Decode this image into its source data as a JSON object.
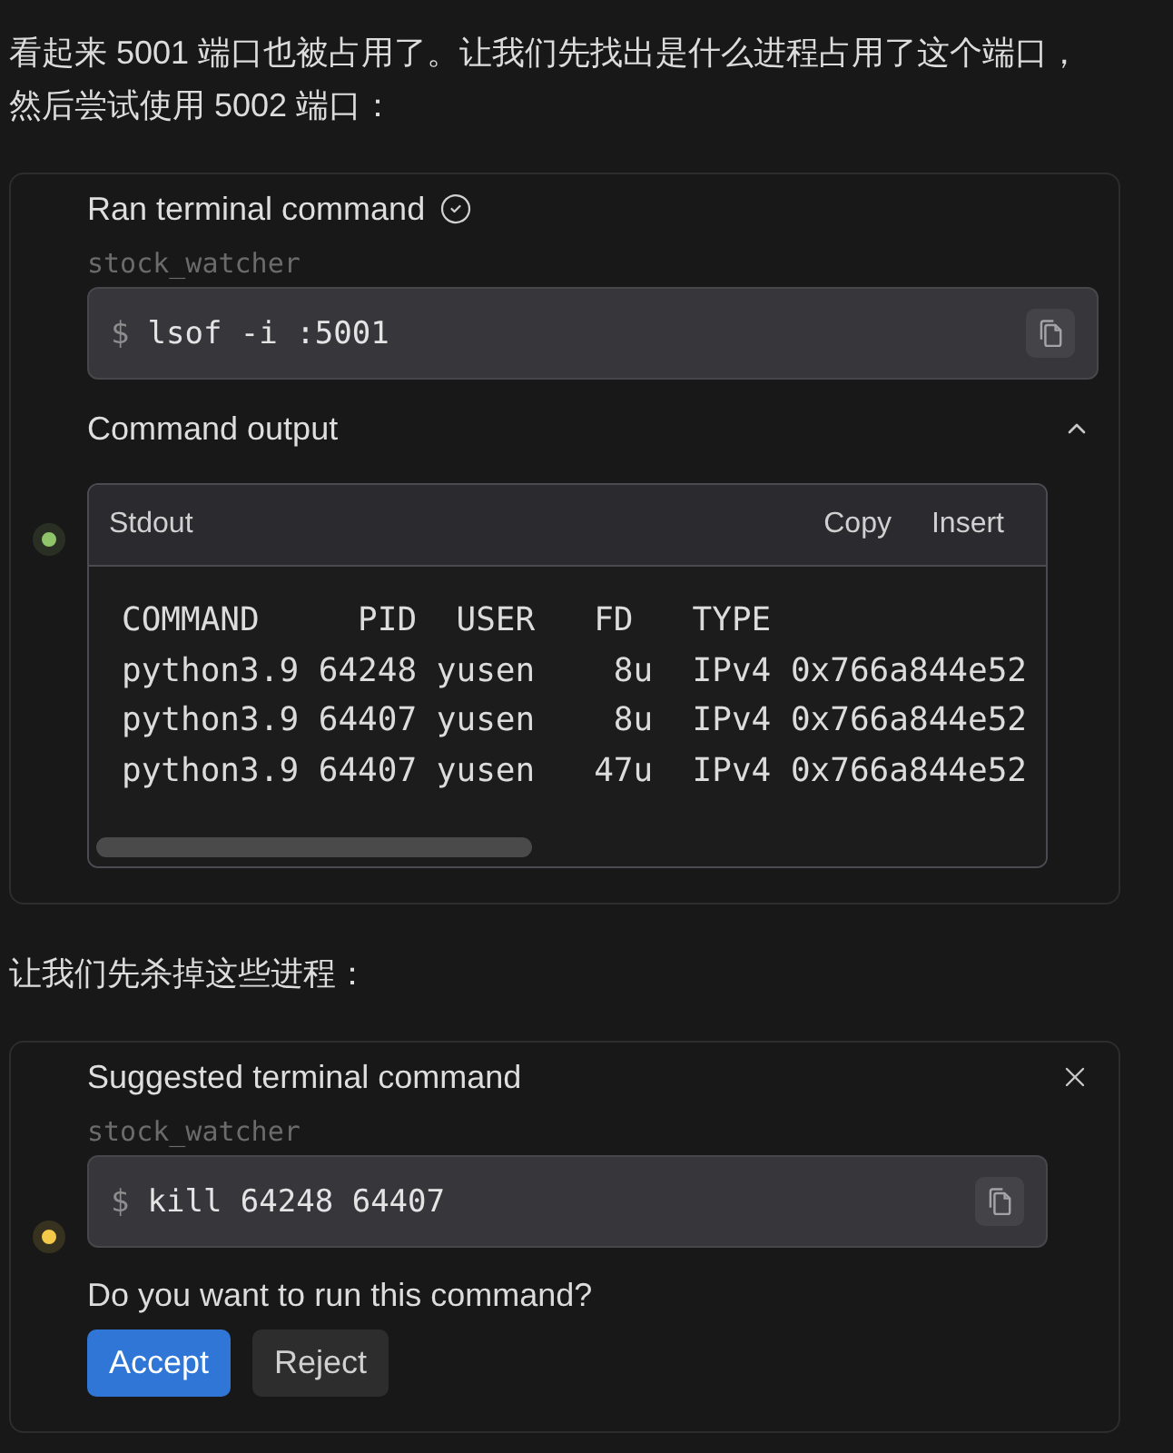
{
  "messages": [
    {
      "kind": "text",
      "text": "看起来 5001 端口也被占用了。让我们先找出是什么进程占用了这个端口，然后尝试使用 5002 端口："
    },
    {
      "kind": "ran_command",
      "title": "Ran terminal command",
      "done": true,
      "color": "#8fc46a",
      "cwd": "stock_watcher",
      "prompt": "$",
      "command": "lsof -i :5001",
      "output": {
        "label": "Command output",
        "expanded": true,
        "stream": "Stdout",
        "actions": [
          "Copy",
          "Insert"
        ],
        "lines": [
          "COMMAND     PID  USER   FD   TYPE",
          "python3.9 64248 yusen    8u  IPv4 0x766a844e52",
          "python3.9 64407 yusen    8u  IPv4 0x766a844e52",
          "python3.9 64407 yusen   47u  IPv4 0x766a844e52"
        ]
      }
    },
    {
      "kind": "text",
      "text": "让我们先杀掉这些进程："
    },
    {
      "kind": "suggested_command",
      "title": "Suggested terminal command",
      "dismissible": true,
      "color": "#f4c94a",
      "cwd": "stock_watcher",
      "prompt": "$",
      "command": "kill 64248 64407",
      "question": "Do you want to run this command?",
      "buttons": [
        {
          "label": "Accept",
          "kind": "primary"
        },
        {
          "label": "Reject",
          "kind": "secondary"
        }
      ]
    }
  ]
}
